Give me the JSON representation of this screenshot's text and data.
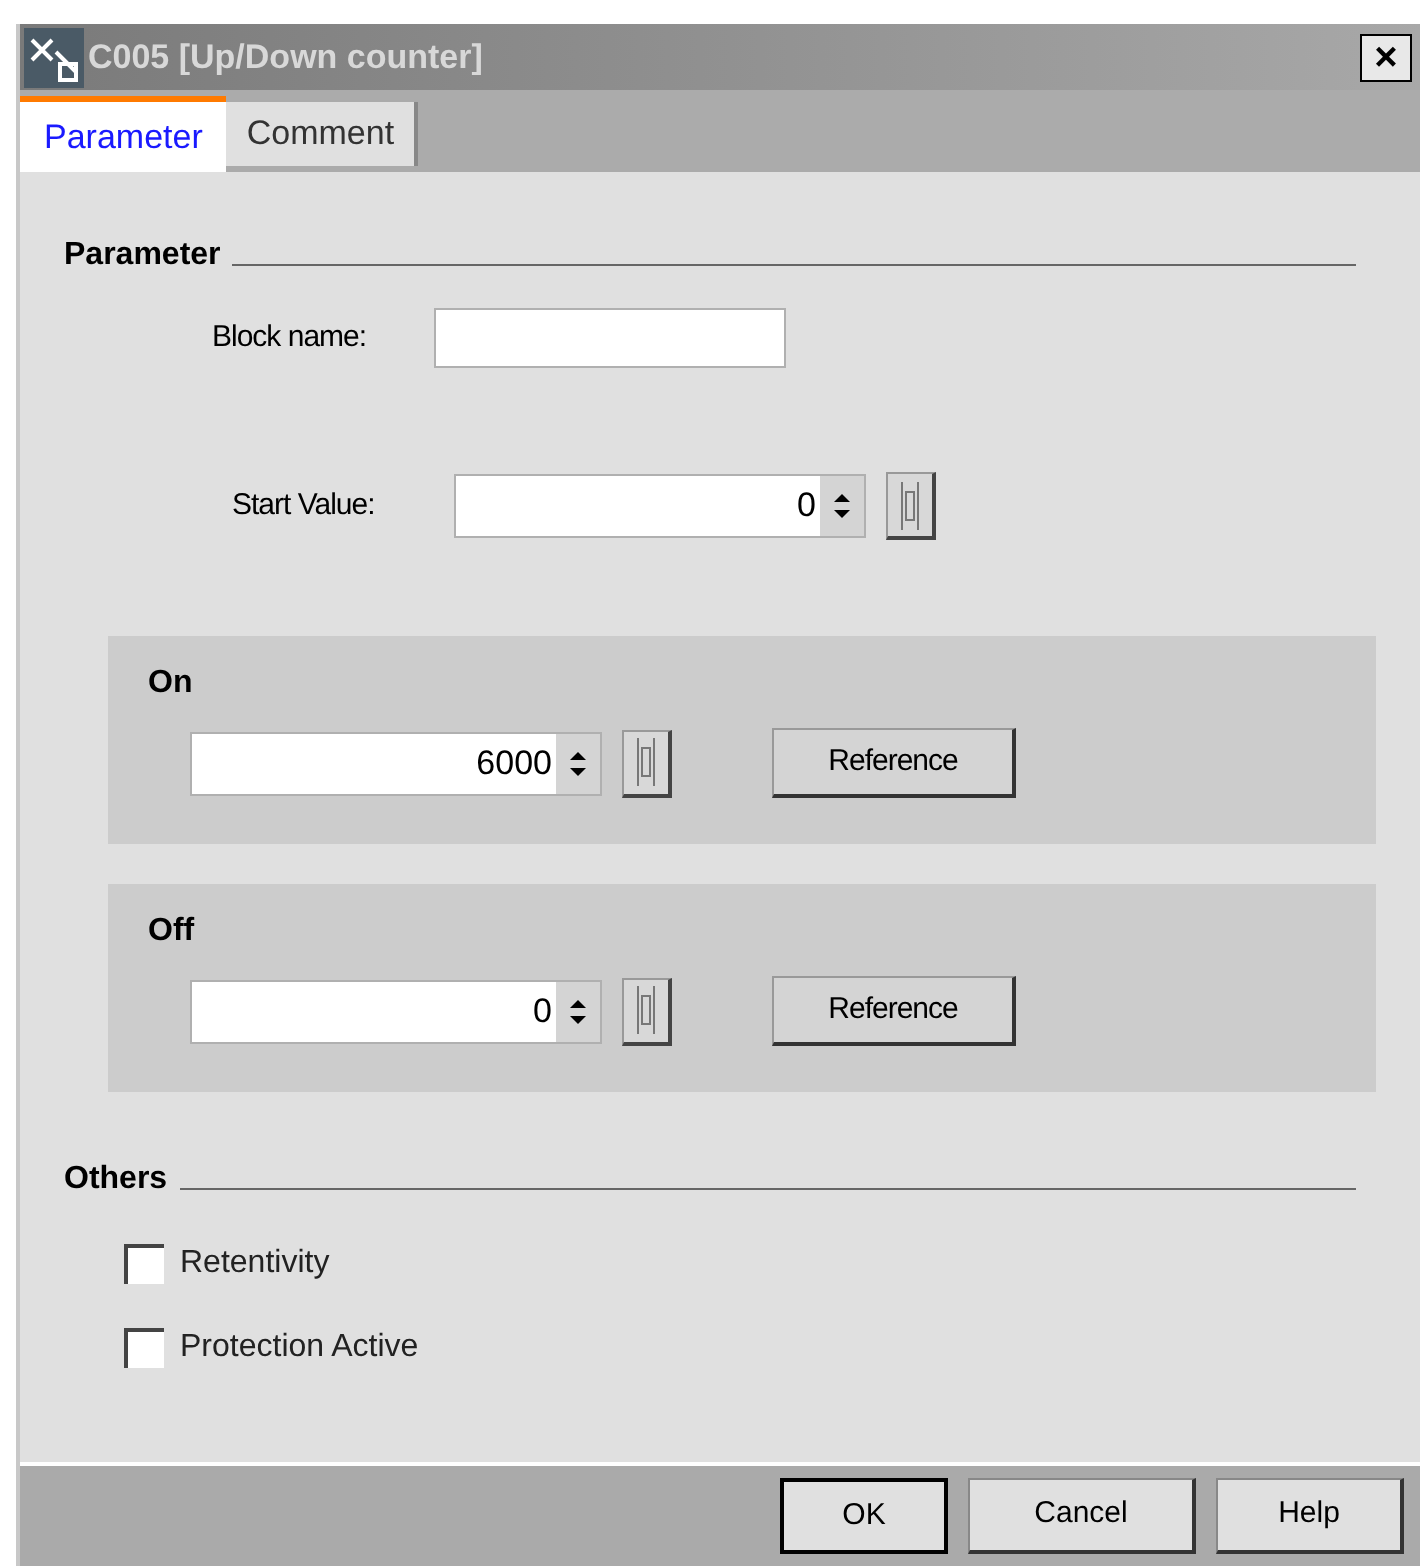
{
  "window": {
    "title": "C005 [Up/Down counter]",
    "close": "×"
  },
  "tabs": [
    {
      "label": "Parameter",
      "selected": true
    },
    {
      "label": "Comment",
      "selected": false
    }
  ],
  "parameter_section": {
    "heading": "Parameter",
    "block_name": {
      "label": "Block name:"
    },
    "start_value": {
      "label": "Start Value:",
      "value": "0"
    }
  },
  "groups": [
    {
      "heading": "On",
      "value": "6000",
      "button": "Reference"
    },
    {
      "heading": "Off",
      "value": "0",
      "button": "Reference"
    }
  ],
  "others_section": {
    "heading": "Others",
    "options": [
      {
        "label": "Retentivity",
        "checked": false
      },
      {
        "label": "Protection Active",
        "checked": false
      }
    ]
  },
  "buttons": [
    {
      "label": "OK",
      "default": true
    },
    {
      "label": "Cancel",
      "default": false
    },
    {
      "label": "Help",
      "default": false
    }
  ]
}
